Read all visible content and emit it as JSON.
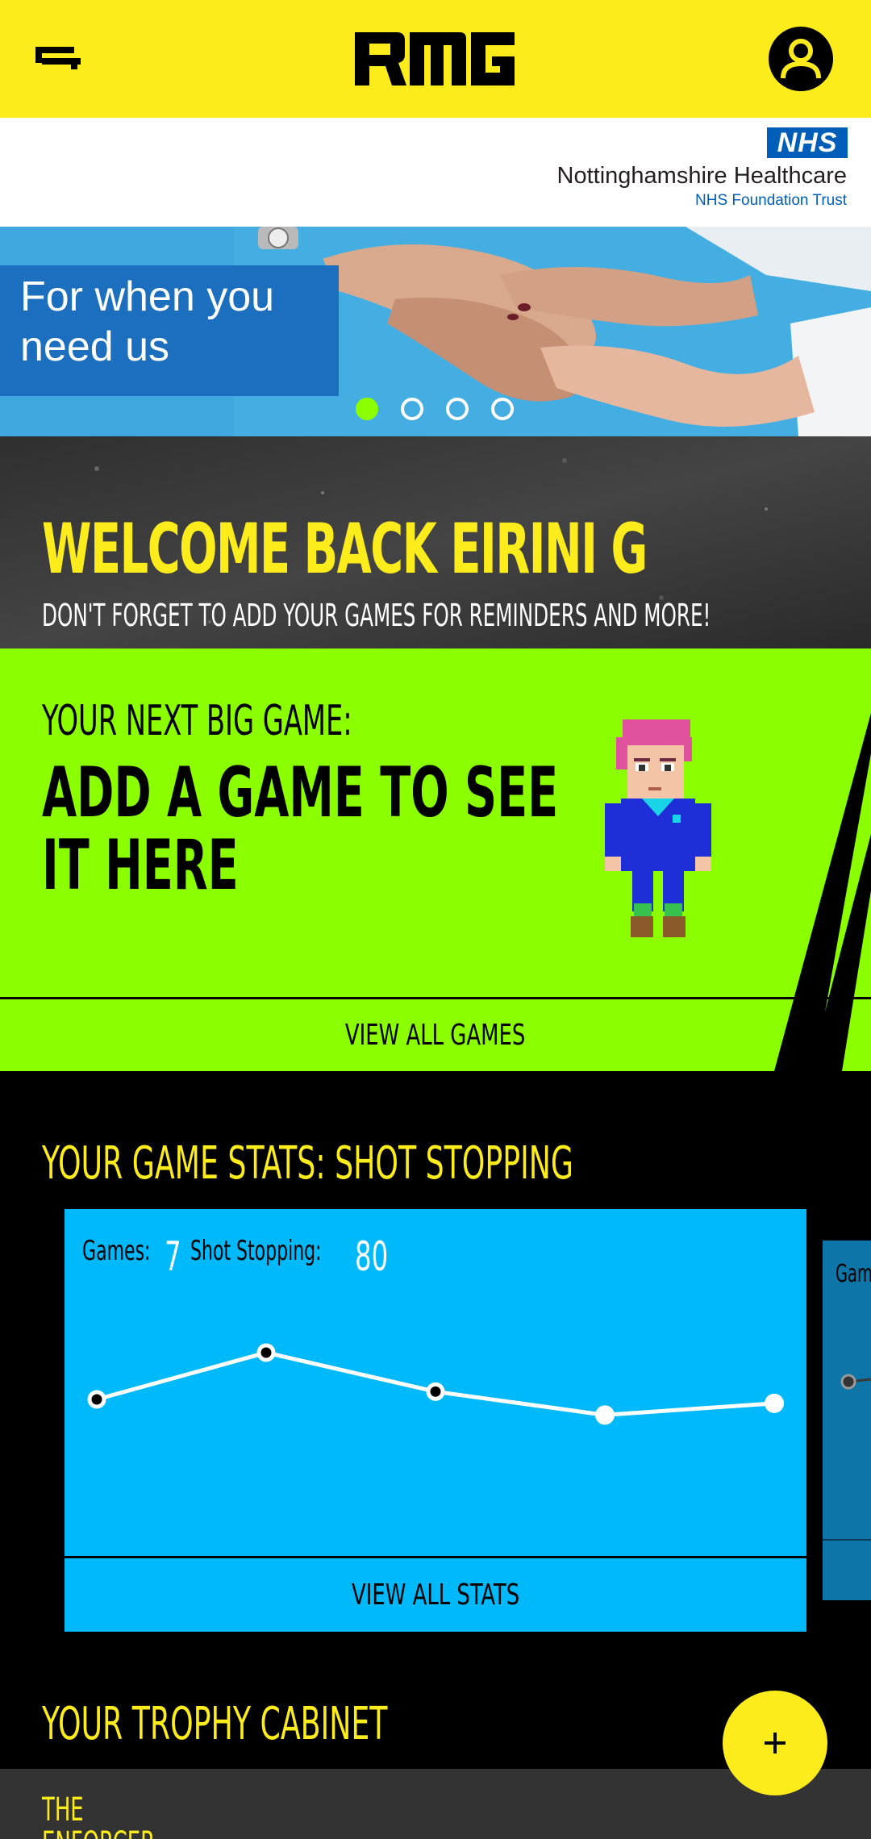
{
  "header": {
    "menu_icon": "hamburger-menu-icon",
    "logo_text": "RMG",
    "profile_icon": "user-profile-icon"
  },
  "sponsor": {
    "badge": "NHS",
    "org_name": "Nottinghamshire Healthcare",
    "org_sub": "NHS Foundation Trust"
  },
  "banner": {
    "text": "For when you need us",
    "slide_count": 4,
    "active_slide": 1
  },
  "welcome": {
    "title": "WELCOME BACK EIRINI G",
    "subtitle": "DON'T FORGET TO ADD YOUR GAMES FOR REMINDERS AND MORE!"
  },
  "next_game": {
    "label": "YOUR NEXT BIG GAME:",
    "title": "ADD A GAME TO SEE IT HERE",
    "button": "VIEW ALL GAMES"
  },
  "stats": {
    "title": "YOUR GAME STATS: SHOT STOPPING",
    "games_label": "Games:",
    "games_value": "7",
    "metric_label": "Shot Stopping:",
    "metric_value": "80",
    "button": "VIEW ALL STATS",
    "next_card_label": "Gam"
  },
  "chart_data": {
    "type": "line",
    "series": [
      {
        "values": [
          78,
          84,
          79,
          76,
          77.5
        ]
      }
    ],
    "markers": [
      "black",
      "black",
      "black",
      "white",
      "white"
    ],
    "ylim": [
      60,
      90
    ],
    "grid": false
  },
  "trophy": {
    "title": "YOUR TROPHY CABINET",
    "first_item": "THE ENFORCER"
  },
  "fab": {
    "icon": "plus-icon"
  },
  "colors": {
    "yellow": "#FCEC1C",
    "lime": "#8BFF00",
    "cyan": "#00B9FA",
    "nhs_blue": "#005EB8"
  }
}
